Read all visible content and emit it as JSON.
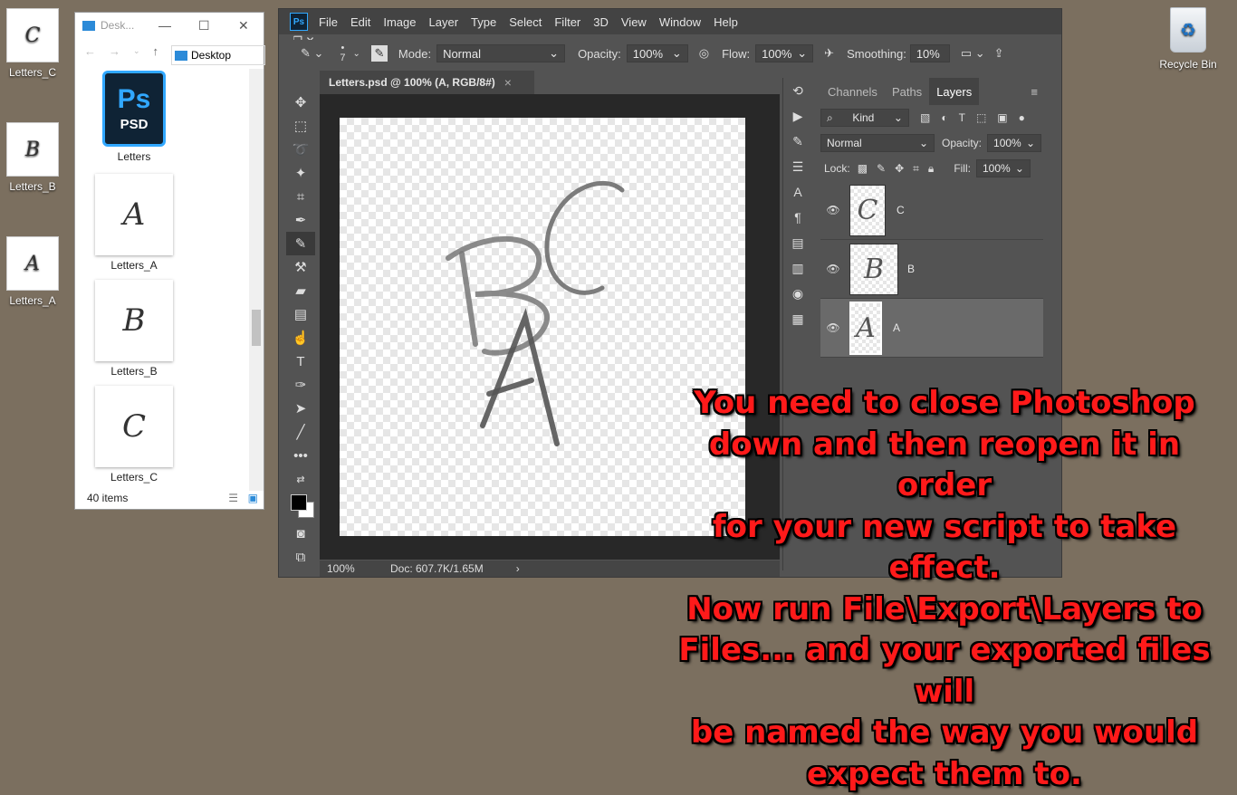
{
  "desktop": {
    "icons": [
      {
        "label": "Letters_C",
        "glyph": "C"
      },
      {
        "label": "Letters_B",
        "glyph": "B"
      },
      {
        "label": "Letters_A",
        "glyph": "A"
      }
    ],
    "recycle_bin": {
      "label": "Recycle Bin",
      "icon": "recycle-icon"
    }
  },
  "explorer": {
    "title": "Desk...",
    "address": "Desktop",
    "items": [
      {
        "label": "Letters",
        "type": "psd",
        "logo_big": "Ps",
        "logo_small": "PSD"
      },
      {
        "label": "Letters_A",
        "glyph": "A"
      },
      {
        "label": "Letters_B",
        "glyph": "B"
      },
      {
        "label": "Letters_C",
        "glyph": "C"
      }
    ],
    "status": "40 items"
  },
  "photoshop": {
    "logo": "Ps",
    "menu": [
      "File",
      "Edit",
      "Image",
      "Layer",
      "Type",
      "Select",
      "Filter",
      "3D",
      "View",
      "Window",
      "Help"
    ],
    "options": {
      "brush_size": "7",
      "mode_label": "Mode:",
      "mode_value": "Normal",
      "opacity_label": "Opacity:",
      "opacity_value": "100%",
      "flow_label": "Flow:",
      "flow_value": "100%",
      "smoothing_label": "Smoothing:",
      "smoothing_value": "10%"
    },
    "doc_tab": "Letters.psd @ 100% (A, RGB/8#)",
    "doc_tab_close": "×",
    "status": {
      "zoom": "100%",
      "doc": "Doc: 607.7K/1.65M"
    },
    "panel": {
      "tabs": [
        "Channels",
        "Paths",
        "Layers"
      ],
      "kind": "Kind",
      "blend": "Normal",
      "opacity_label": "Opacity:",
      "opacity_value": "100%",
      "lock_label": "Lock:",
      "fill_label": "Fill:",
      "fill_value": "100%",
      "layers": [
        {
          "name": "C",
          "glyph": "C",
          "selected": false
        },
        {
          "name": "B",
          "glyph": "B",
          "selected": false
        },
        {
          "name": "A",
          "glyph": "A",
          "selected": true
        }
      ]
    }
  },
  "caption": {
    "lines": [
      "You need to close Photoshop",
      "down and then reopen it in order",
      "for your new script to take effect.",
      "Now run File\\Export\\Layers to",
      "Files... and your exported files will",
      "be named the way you would",
      "expect them to."
    ]
  }
}
